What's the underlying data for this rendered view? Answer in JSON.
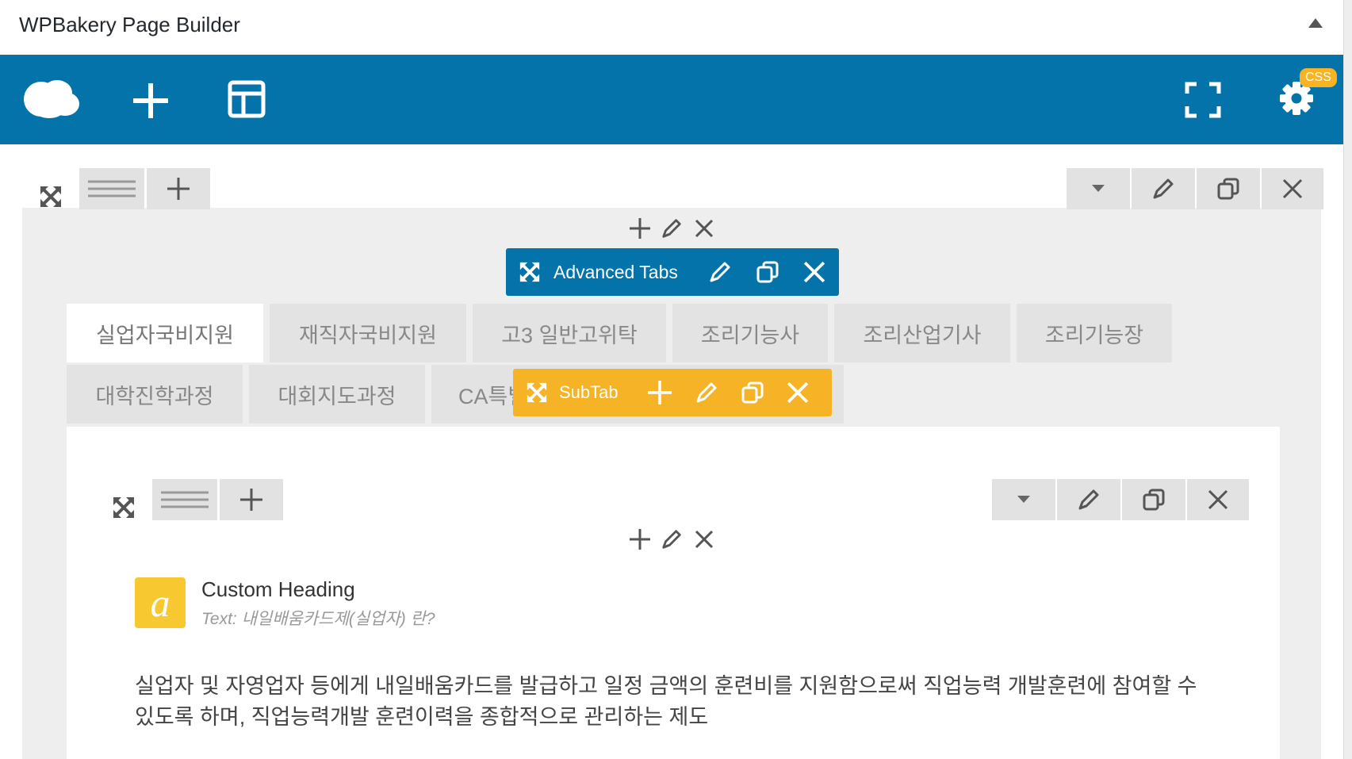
{
  "header": {
    "title": "WPBakery Page Builder"
  },
  "toolbar": {
    "css_badge": "CSS"
  },
  "advanced_tabs": {
    "label": "Advanced Tabs"
  },
  "subtab": {
    "label": "SubTab"
  },
  "tabs_row1": [
    {
      "label": "실업자국비지원",
      "active": true
    },
    {
      "label": "재직자국비지원",
      "active": false
    },
    {
      "label": "고3 일반고위탁",
      "active": false
    },
    {
      "label": "조리기능사",
      "active": false
    },
    {
      "label": "조리산업기사",
      "active": false
    },
    {
      "label": "조리기능장",
      "active": false
    }
  ],
  "tabs_row2": [
    {
      "label": "대학진학과정"
    },
    {
      "label": "대회지도과정"
    },
    {
      "label": "CA특별"
    }
  ],
  "custom_heading": {
    "icon_letter": "a",
    "title": "Custom Heading",
    "subtitle": "Text: 내일배움카드제(실업자) 란?"
  },
  "body_text": "실업자 및 자영업자 등에게 내일배움카드를 발급하고 일정 금액의 훈련비를 지원함으로써 직업능력 개발훈련에 참여할 수 있도록 하며, 직업능력개발 훈련이력을 종합적으로 관리하는 제도",
  "colors": {
    "toolbar_blue": "#0473aa",
    "subtab_orange": "#f5b325",
    "heading_yellow": "#f7c82f"
  }
}
